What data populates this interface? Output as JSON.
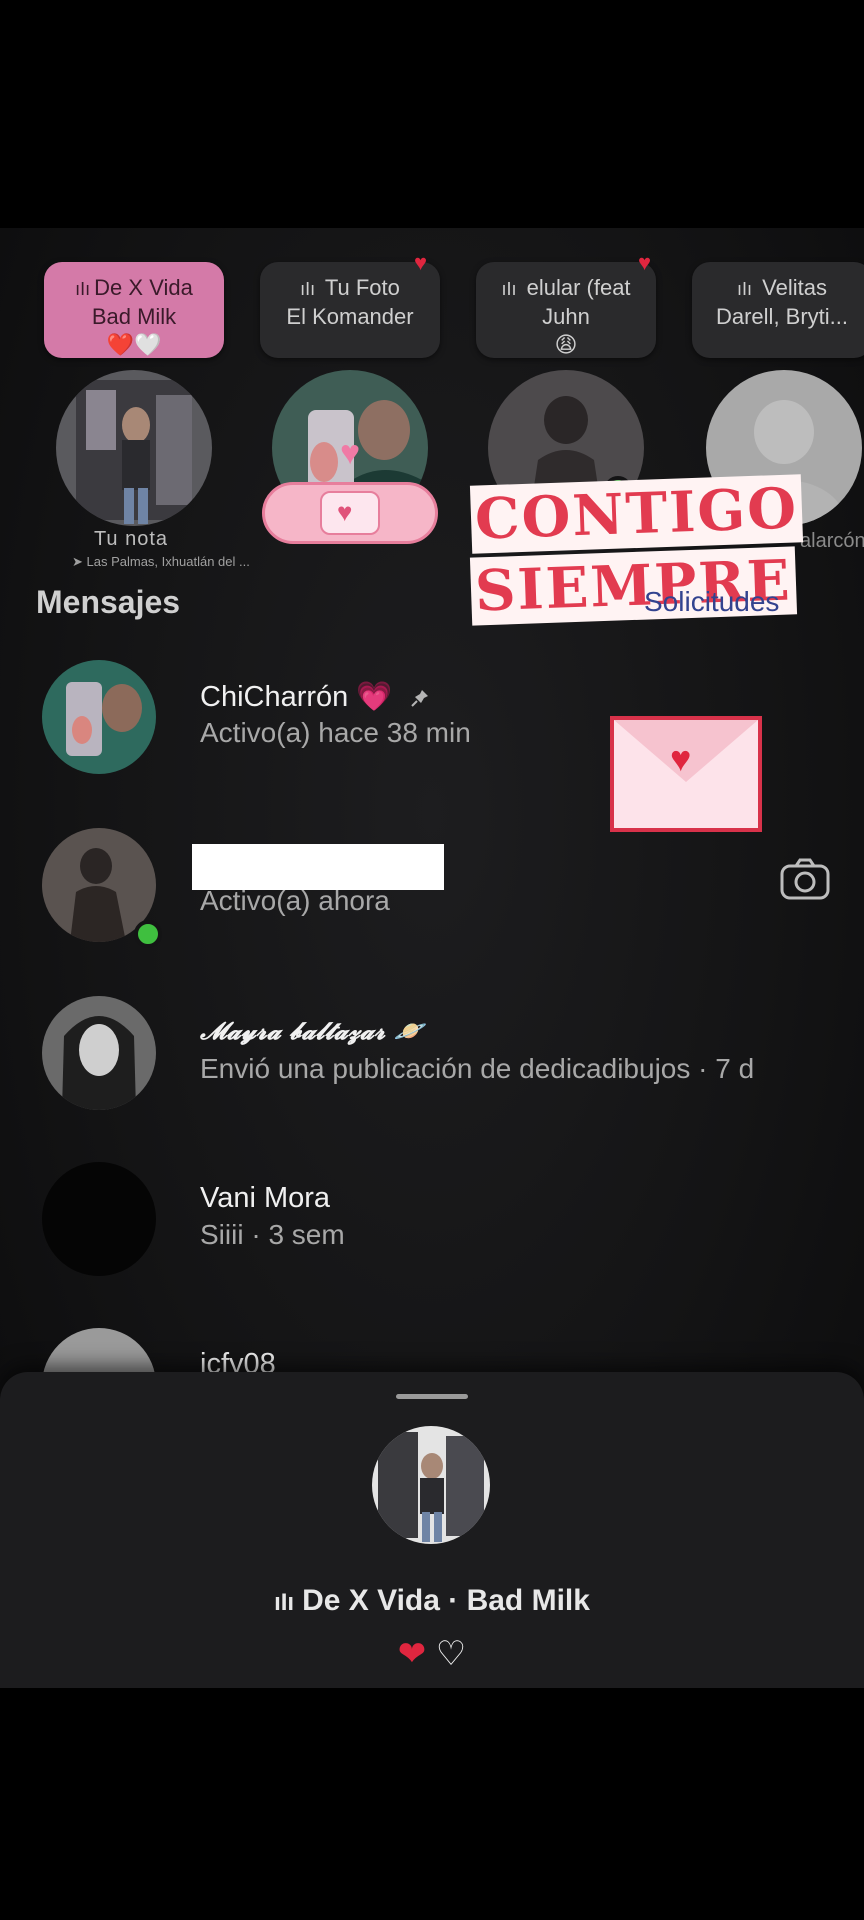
{
  "notes": [
    {
      "song": "De X Vida",
      "artist": "Bad Milk",
      "emoji": "❤️🤍",
      "name": "Tu nota",
      "location": "Las Palmas, Ixhuatlán del ..."
    },
    {
      "song": "Tu Foto",
      "artist": "El Komander"
    },
    {
      "song": "elular (feat",
      "artist": "Juhn",
      "emoji": "😩"
    },
    {
      "song": "Velitas",
      "artist": "Darell, Bryti...",
      "name": "alarcón"
    }
  ],
  "stickers": {
    "headline_line1": "CONTIGO",
    "headline_line2": "SIEMPRE"
  },
  "section_title": "Mensajes",
  "requests_label": "Solicitudes",
  "messages": [
    {
      "name": "ChiCharrón",
      "emoji": "💗",
      "subtitle": "Activo(a) hace 38 min"
    },
    {
      "name": "",
      "subtitle": "Activo(a) ahora"
    },
    {
      "name": "𝓜𝓪𝔂𝓻𝓪 𝓫𝓪𝓵𝓽𝓪𝔃𝓪𝓻",
      "emoji": "🪐",
      "subtitle": "Envió una publicación de dedicadibujos · 7 d"
    },
    {
      "name": "Vani Mora",
      "subtitle": "Siiii · 3 sem"
    },
    {
      "name": "icfy08",
      "subtitle": ""
    }
  ],
  "sheet": {
    "song_line": "De X Vida · Bad Milk",
    "hearts_red": "❤",
    "hearts_white": "♡"
  },
  "colors": {
    "accent_pink": "#d47aa8",
    "online_green": "#3fbf3f",
    "requests_blue": "#33438f"
  }
}
